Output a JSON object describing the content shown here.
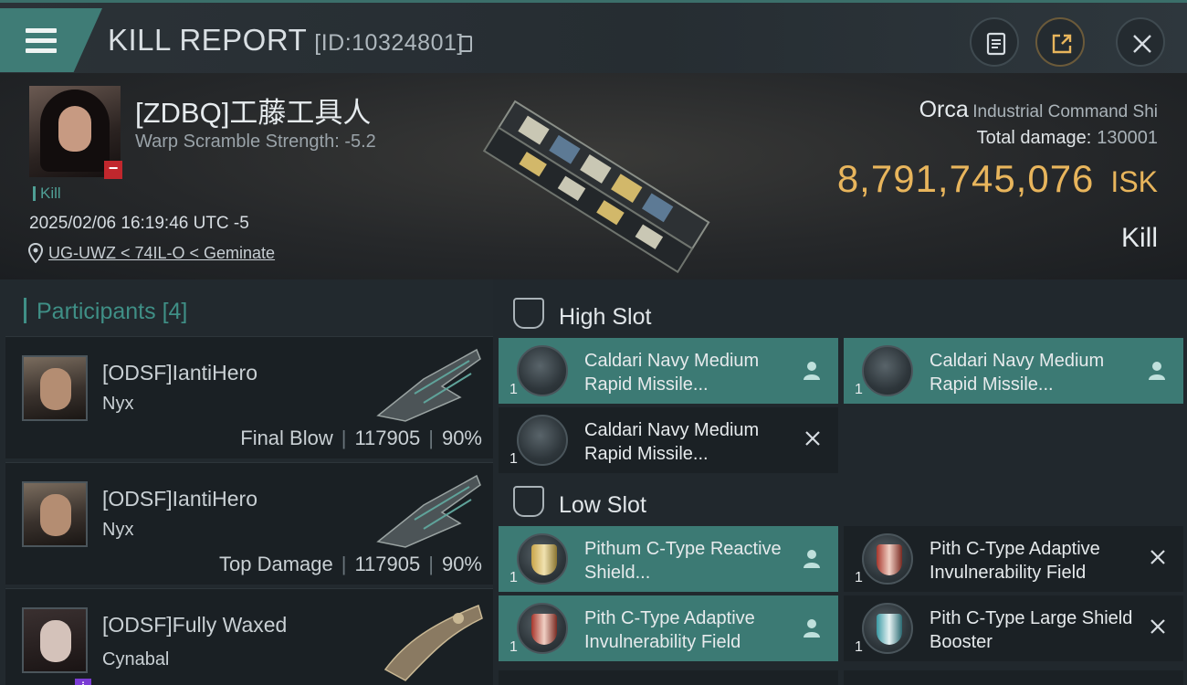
{
  "window": {
    "title": "KILL REPORT",
    "report_id": "[ID:10324801]"
  },
  "victim": {
    "name": "[ZDBQ]工藤工具人",
    "warp_scramble": "Warp Scramble Strength: -5.2",
    "kill_tag": "Kill",
    "datetime": "2025/02/06 16:19:46 UTC -5",
    "location": "UG-UWZ < 74IL-O < Geminate",
    "ship_name": "Orca",
    "ship_class": "Industrial Command Shi",
    "damage_label": "Total damage:",
    "damage_value": "130001",
    "isk_value": "8,791,745,076",
    "isk_unit": "ISK",
    "result": "Kill"
  },
  "participants": {
    "header": "Participants",
    "count": "[4]",
    "rows": [
      {
        "name": "[ODSF]IantiHero",
        "ship": "Nyx",
        "role": "Final Blow",
        "damage": "117905",
        "percent": "90%"
      },
      {
        "name": "[ODSF]IantiHero",
        "ship": "Nyx",
        "role": "Top Damage",
        "damage": "117905",
        "percent": "90%"
      },
      {
        "name": "[ODSF]Fully Waxed",
        "ship": "Cynabal"
      }
    ]
  },
  "slots": {
    "high": {
      "title": "High Slot",
      "modules": [
        {
          "name": "Caldari Navy Medium Rapid Missile...",
          "qty": "1",
          "state": "person-icon",
          "highlighted": true
        },
        {
          "name": "Caldari Navy Medium Rapid Missile...",
          "qty": "1",
          "state": "person-icon",
          "highlighted": true
        },
        {
          "name": "Caldari Navy Medium Rapid Missile...",
          "qty": "1",
          "state": "close-icon",
          "highlighted": false
        }
      ]
    },
    "low": {
      "title": "Low Slot",
      "modules": [
        {
          "name": "Pithum C-Type Reactive Shield...",
          "qty": "1",
          "state": "person-icon",
          "highlighted": true
        },
        {
          "name": "Pith C-Type Adaptive Invulnerability Field",
          "qty": "1",
          "state": "close-icon",
          "highlighted": false
        },
        {
          "name": "Pith C-Type Adaptive Invulnerability Field",
          "qty": "1",
          "state": "person-icon",
          "highlighted": true
        },
        {
          "name": "Pith C-Type Large Shield Booster",
          "qty": "1",
          "state": "close-icon",
          "highlighted": false
        }
      ]
    }
  },
  "colors": {
    "accent": "#3f8f86",
    "highlight_row": "#3c7a74",
    "isk": "#e8b55c",
    "hostile_badge": "#c1272d"
  }
}
